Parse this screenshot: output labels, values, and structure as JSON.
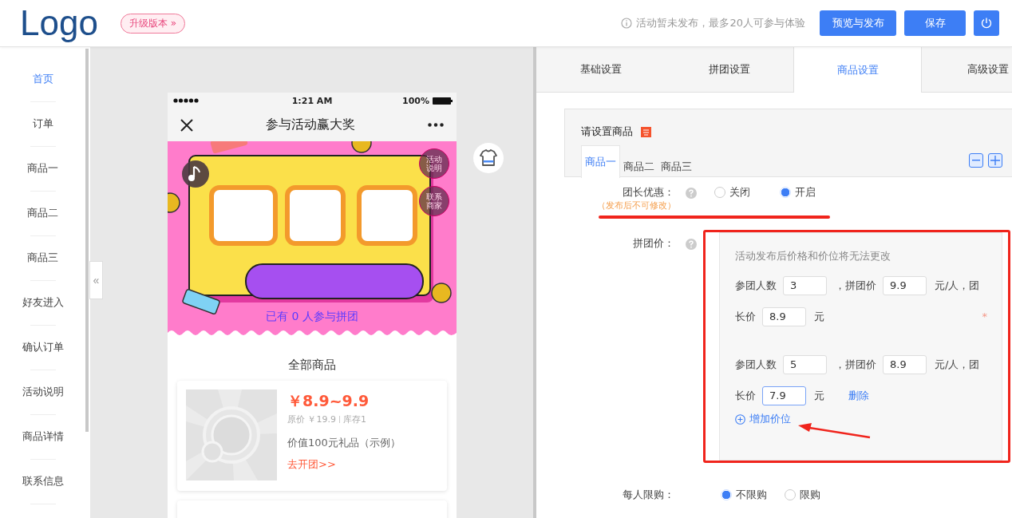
{
  "header": {
    "logo": "Logo",
    "badge": "升级版本 »",
    "notice": "活动暂未发布，最多20人可参与体验",
    "buttons": [
      "预览与发布",
      "保存"
    ]
  },
  "sidebar": {
    "items": [
      {
        "label": "首页",
        "selected": true
      },
      {
        "label": "订单",
        "selected": false
      },
      {
        "label": "商品一",
        "selected": false
      },
      {
        "label": "商品二",
        "selected": false
      },
      {
        "label": "商品三",
        "selected": false
      },
      {
        "label": "好友进入",
        "selected": false
      },
      {
        "label": "确认订单",
        "selected": false
      },
      {
        "label": "活动说明",
        "selected": false
      },
      {
        "label": "商品详情",
        "selected": false
      },
      {
        "label": "联系信息",
        "selected": false
      }
    ]
  },
  "collapse": "«",
  "preview": {
    "status_bar": {
      "time": "1:21 AM",
      "battery": "100%"
    },
    "nav": {
      "title": "参与活动赢大奖"
    },
    "banner": {
      "buttons": [
        "活动说明",
        "联系商家"
      ],
      "participants": "已有 0 人参与拼团"
    },
    "section_title": "全部商品",
    "products": [
      {
        "price": "￥8.9~9.9",
        "original": "原价 ￥19.9",
        "stock": "库存1",
        "name": "价值100元礼品（示例）",
        "action": "去开团>>"
      }
    ]
  },
  "settings": {
    "tabs": [
      {
        "label": "基础设置",
        "selected": false
      },
      {
        "label": "拼团设置",
        "selected": false
      },
      {
        "label": "商品设置",
        "selected": true
      },
      {
        "label": "高级设置",
        "selected": false
      }
    ],
    "product_panel": {
      "title": "请设置商品",
      "tabs": [
        {
          "label": "商品一",
          "selected": true
        },
        {
          "label": "商品二",
          "selected": false
        },
        {
          "label": "商品三",
          "selected": false
        }
      ]
    },
    "leader_discount": {
      "label": "团长优惠：",
      "note": "（发布后不可修改）",
      "options": [
        {
          "label": "关闭",
          "selected": false
        },
        {
          "label": "开启",
          "selected": true
        }
      ]
    },
    "group_price": {
      "label": "拼团价：",
      "hint": "活动发布后价格和价位将无法更改",
      "tiers": [
        {
          "people_label": "参团人数",
          "people": "3",
          "price_label": "，拼团价",
          "price": "9.9",
          "unit": "元/人，团",
          "leader_label": "长价",
          "leader_price": "8.9",
          "leader_unit": "元",
          "focused": false,
          "required": "*"
        },
        {
          "people_label": "参团人数",
          "people": "5",
          "price_label": "，拼团价",
          "price": "8.9",
          "unit": "元/人，团",
          "leader_label": "长价",
          "leader_price": "7.9",
          "leader_unit": "元",
          "focused": true,
          "delete": "删除"
        }
      ],
      "add": "增加价位"
    },
    "purchase_limit": {
      "label": "每人限购：",
      "options": [
        {
          "label": "不限购",
          "selected": true
        },
        {
          "label": "限购",
          "selected": false
        }
      ]
    }
  }
}
